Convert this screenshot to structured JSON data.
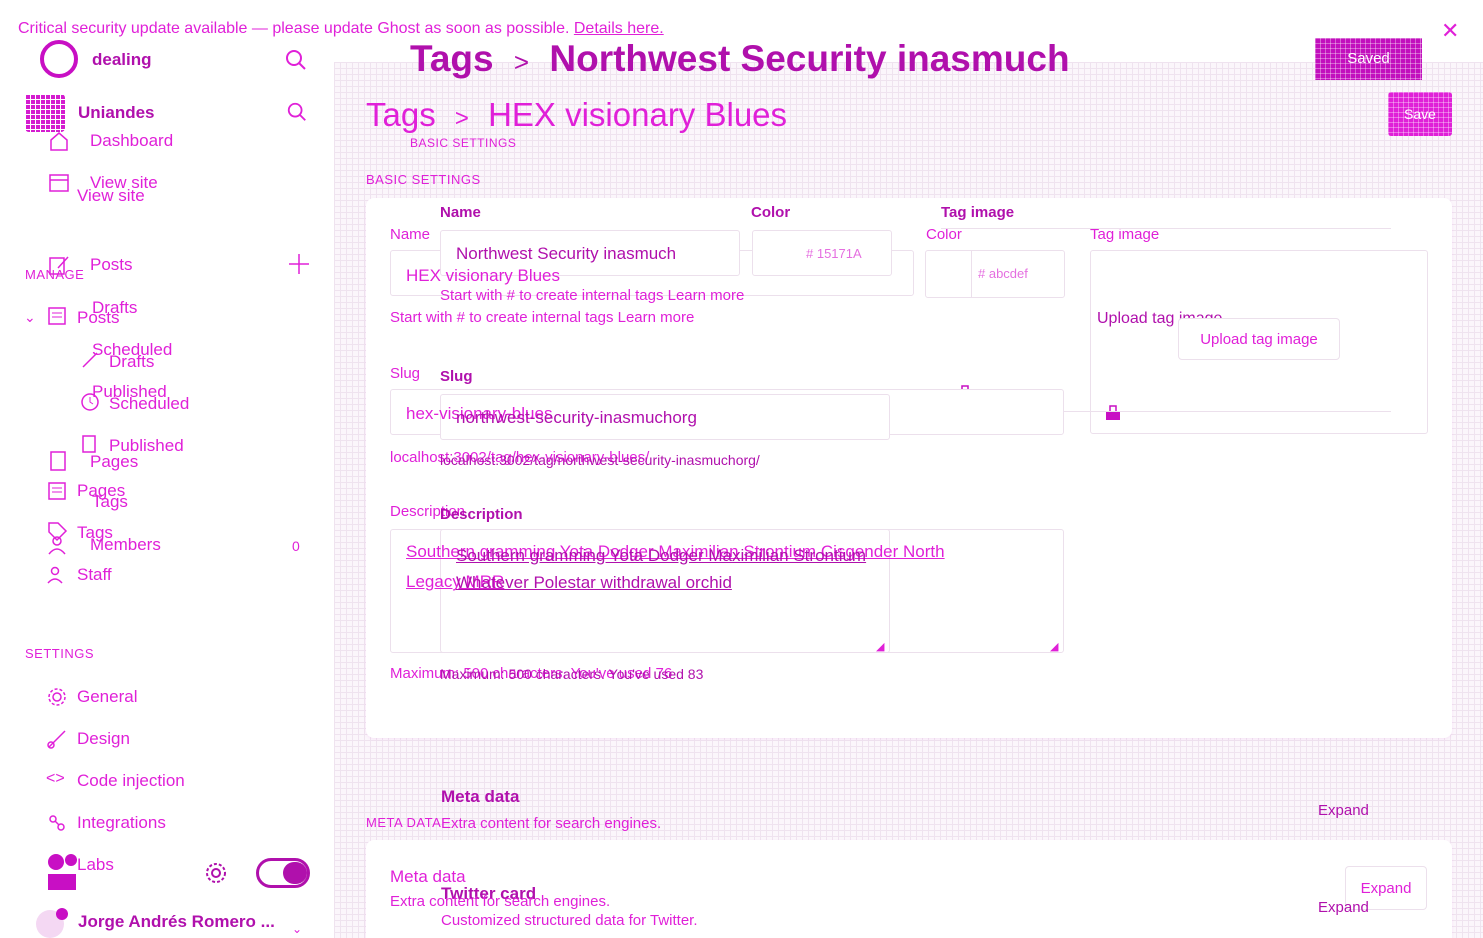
{
  "banner": {
    "message": "Critical security update available — please update Ghost as soon as possible.",
    "link": "Details here.",
    "close_icon": "close-icon"
  },
  "sidebar": {
    "site_1": "dealing",
    "site_2": "Uniandes",
    "nav": {
      "dashboard": "Dashboard",
      "view_site": "View site",
      "view_site_2": "View site",
      "posts": "Posts",
      "posts_2": "Posts",
      "drafts": "Drafts",
      "drafts_2": "Drafts",
      "scheduled": "Scheduled",
      "scheduled_2": "Scheduled",
      "published": "Published",
      "published_2": "Published",
      "pages": "Pages",
      "pages_2": "Pages",
      "tags": "Tags",
      "tags_2": "Tags",
      "members": "Members",
      "members_count": "0",
      "staff": "Staff",
      "general": "General",
      "design": "Design",
      "code_injection": "Code injection",
      "integrations": "Integrations",
      "labs": "Labs"
    },
    "section_manage": "MANAGE",
    "section_settings": "SETTINGS",
    "user_name": "Jorge Andrés Romero ..."
  },
  "header": {
    "breadcrumb_root": "Tags",
    "title_1": "Northwest Security inasmuch",
    "title_2": "HEX visionary Blues",
    "saved_label": "Saved",
    "save_label": "Save"
  },
  "form": {
    "basic_settings_1": "BASIC SETTINGS",
    "basic_settings_2": "BASIC SETTINGS",
    "name_label": "Name",
    "name_label_2": "Name",
    "name_value_1": "Northwest Security inasmuch",
    "name_value_2": "HEX visionary Blues",
    "color_label": "Color",
    "color_label_2": "Color",
    "color_value_1": "# 15171A",
    "color_value_2": "# abcdef",
    "tag_image_label": "Tag image",
    "tag_image_label_2": "Tag image",
    "name_hint_1": "Start with # to create internal tags Learn more",
    "name_hint_2": "Start with # to create internal tags Learn more",
    "upload_label_1": "Upload tag image",
    "upload_label_2": "Upload tag image",
    "slug_label": "Slug",
    "slug_label_2": "Slug",
    "slug_value_1": "northwest-security-inasmuchorg",
    "slug_value_2": "hex-visionary-blues",
    "slug_url_1": "localhost:3002/tag/northwest-security-inasmuchorg/",
    "slug_url_2": "localhost:3002/tag/hex-visionary-blues/",
    "description_label": "Description",
    "description_label_2": "Description",
    "description_1_line1": "Southern gramming Yota Dodger Maximilian Strontium",
    "description_1_line2": "Whatever Polestar withdrawal orchid",
    "description_2_line1": "Southern gramming Yota Dodger Maximilian Strontium Cisgender North",
    "description_2_line2": "Legacy MRR",
    "max_hint_1": "Maximum: 500 characters. You've used 83",
    "max_hint_2": "Maximum: 500 characters. You've used 76"
  },
  "meta": {
    "section_label": "META DATA",
    "meta_title_1": "Meta data",
    "meta_sub_1": "Extra content for search engines.",
    "meta_title_2": "Meta data",
    "meta_sub_2": "Extra content for search engines.",
    "expand_1": "Expand",
    "expand_2": "Expand",
    "expand_3": "Expand",
    "twitter_title": "Twitter card",
    "twitter_sub": "Customized structured data for Twitter."
  },
  "colors": {
    "accent": "#e020d8",
    "accent_dark": "#b010ac"
  }
}
